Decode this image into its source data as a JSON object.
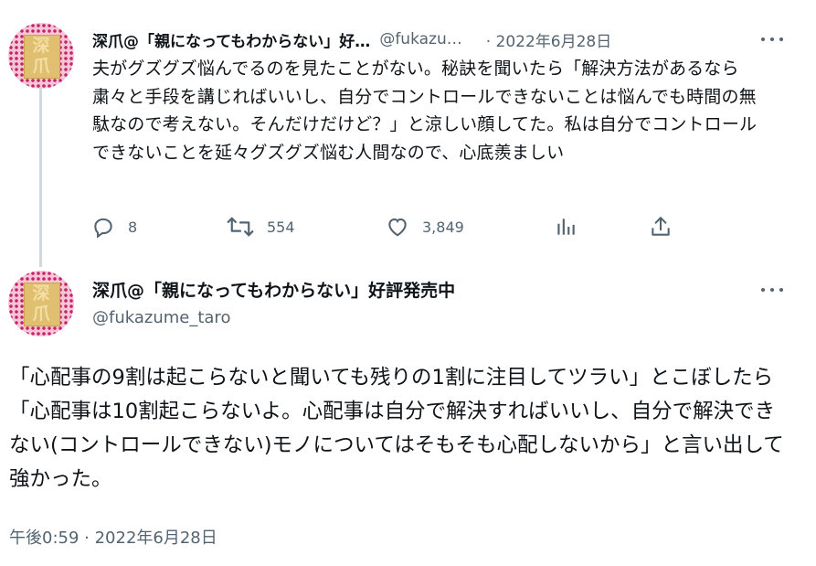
{
  "tweet1": {
    "author_name": "深爪@「親になってもわからない」好…",
    "author_handle": "@fukazu…",
    "separator_date": "· 2022年6月28日",
    "avatar_text_top": "深",
    "avatar_text_bottom": "爪",
    "body": "夫がグズグズ悩んでるのを見たことがない。秘訣を聞いたら「解決方法があるなら粛々と手段を講じればいいし、自分でコントロールできないことは悩んでも時間の無駄なので考えない。そんだけだけど？」と涼しい顔してた。私は自分でコントロールできないことを延々グズグズ悩む人間なので、心底羨ましい",
    "replies": "8",
    "retweets": "554",
    "likes": "3,849"
  },
  "tweet2": {
    "author_name": "深爪@「親になってもわからない」好評発売中",
    "author_handle": "@fukazume_taro",
    "avatar_text_top": "深",
    "avatar_text_bottom": "爪",
    "body": "「心配事の9割は起こらないと聞いても残りの1割に注目してツラい」とこぼしたら「心配事は10割起こらないよ。心配事は自分で解決すればいいし、自分で解決できない(コントロールできない)モノについてはそもそも心配しないから」と言い出して強かった。",
    "timestamp": "午後0:59 · 2022年6月28日"
  },
  "icons": {
    "reply": "reply-icon",
    "retweet": "retweet-icon",
    "like": "heart-icon",
    "analytics": "analytics-icon",
    "share": "share-icon",
    "more": "more-icon"
  },
  "colors": {
    "text": "#0f1419",
    "muted": "#536471",
    "thread_line": "#cfd9de"
  }
}
